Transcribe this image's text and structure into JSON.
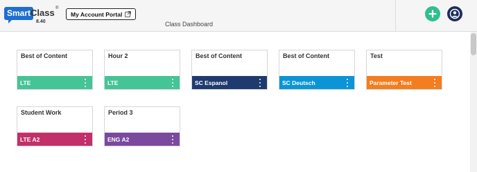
{
  "header": {
    "logo_text": "Smart",
    "logo_word": "Class",
    "logo_reg": "®",
    "version": "8.40",
    "portal_button_label": "My Account Portal",
    "page_title": "Class Dashboard"
  },
  "colors": {
    "green": "#45c496",
    "navy": "#1f3a6e",
    "blue": "#0b95d6",
    "orange": "#f47d20",
    "magenta": "#c2306a",
    "purple": "#7b4a9e"
  },
  "cards": [
    {
      "name": "Best of Content",
      "tag": "LTE",
      "color": "#45c496"
    },
    {
      "name": "Hour 2",
      "tag": "LTE",
      "color": "#45c496"
    },
    {
      "name": "Best of Content",
      "tag": "SC Espanol",
      "color": "#1f3a6e"
    },
    {
      "name": "Best of Content",
      "tag": "SC Deutsch",
      "color": "#0b95d6"
    },
    {
      "name": "Test",
      "tag": "Parameter Test",
      "color": "#f47d20"
    },
    {
      "name": "Student Work",
      "tag": "LTE A2",
      "color": "#c2306a"
    },
    {
      "name": "Period 3",
      "tag": "ENG A2",
      "color": "#7b4a9e"
    }
  ]
}
